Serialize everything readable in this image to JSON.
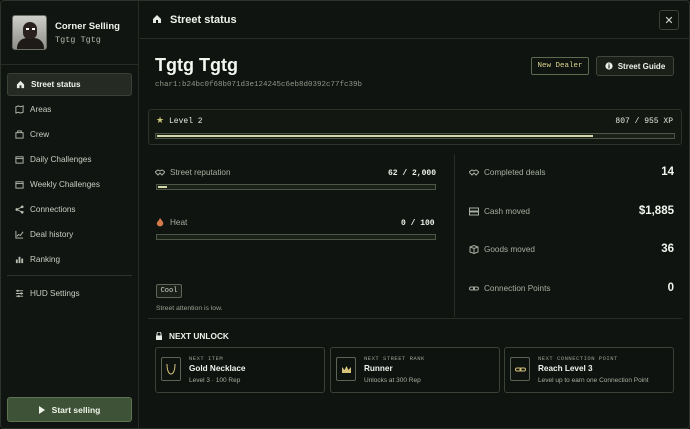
{
  "sidebar": {
    "profile": {
      "title": "Corner Selling",
      "subtitle": "Tgtg Tgtg"
    },
    "items": [
      {
        "label": "Street status",
        "icon": "home-icon",
        "active": true
      },
      {
        "label": "Areas",
        "icon": "map-icon"
      },
      {
        "label": "Crew",
        "icon": "crew-icon"
      },
      {
        "label": "Daily Challenges",
        "icon": "calendar-icon"
      },
      {
        "label": "Weekly Challenges",
        "icon": "calendar-icon"
      },
      {
        "label": "Connections",
        "icon": "share-icon"
      },
      {
        "label": "Deal history",
        "icon": "chart-icon"
      },
      {
        "label": "Ranking",
        "icon": "ranking-icon"
      }
    ],
    "settings_label": "HUD Settings",
    "start_label": "Start selling"
  },
  "header": {
    "title": "Street status",
    "close": "✕"
  },
  "character": {
    "name": "Tgtg Tgtg",
    "id": "char1:b24bc0f68b071d3e124245c6eb8d0392c77fc39b",
    "badge": "New Dealer",
    "guide_label": "Street Guide"
  },
  "level": {
    "label": "Level 2",
    "xp_text": "807 / 955 XP",
    "xp_current": 807,
    "xp_max": 955
  },
  "stats": {
    "reputation": {
      "label": "Street reputation",
      "value": "62 / 2,000",
      "current": 62,
      "max": 2000
    },
    "heat": {
      "label": "Heat",
      "value": "0 / 100",
      "current": 0,
      "max": 100,
      "status": "Cool",
      "note": "Street attention is low."
    },
    "completed_deals": {
      "label": "Completed deals",
      "value": "14"
    },
    "cash_moved": {
      "label": "Cash moved",
      "value": "$1,885"
    },
    "goods_moved": {
      "label": "Goods moved",
      "value": "36"
    },
    "connection_points": {
      "label": "Connection Points",
      "value": "0"
    }
  },
  "next_unlock": {
    "title": "NEXT UNLOCK",
    "cards": [
      {
        "kicker": "NEXT ITEM",
        "title": "Gold Necklace",
        "sub": "Level 3 · 100 Rep",
        "icon": "necklace-icon"
      },
      {
        "kicker": "NEXT STREET RANK",
        "title": "Runner",
        "sub": "Unlocks at 300 Rep",
        "icon": "crown-icon"
      },
      {
        "kicker": "NEXT CONNECTION POINT",
        "title": "Reach Level 3",
        "sub": "Level up to earn one Connection Point",
        "icon": "link-icon"
      }
    ]
  },
  "colors": {
    "accent": "#d5d8a8",
    "start_button": "#3d5236",
    "badge_text": "#d9d48f"
  }
}
